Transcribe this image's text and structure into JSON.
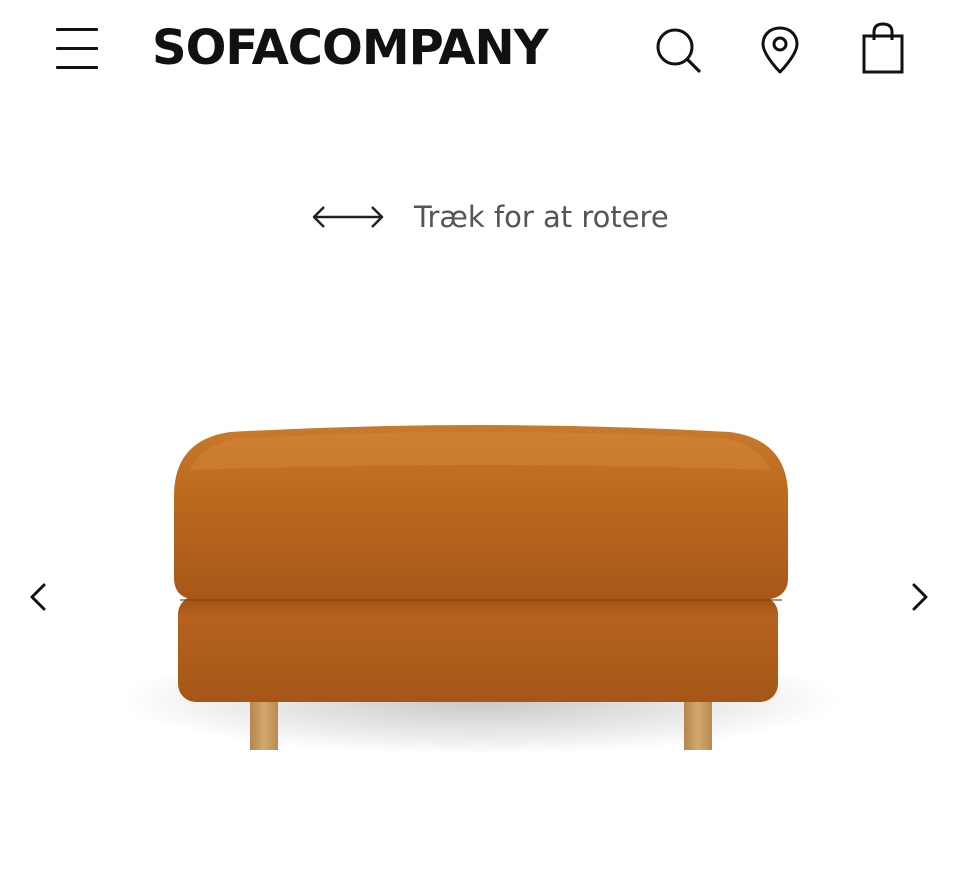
{
  "header": {
    "menu_icon": "hamburger-menu-icon",
    "logo_text": "SOFACOMPANY",
    "search_icon": "search-icon",
    "location_icon": "location-pin-icon",
    "cart_icon": "shopping-bag-icon"
  },
  "viewer": {
    "rotate_hint": "Træk for at rotere",
    "rotate_icon": "double-arrow-icon",
    "prev_icon": "chevron-left-icon",
    "next_icon": "chevron-right-icon",
    "product_color": "#b8661c",
    "leg_color": "#c99a5e"
  }
}
